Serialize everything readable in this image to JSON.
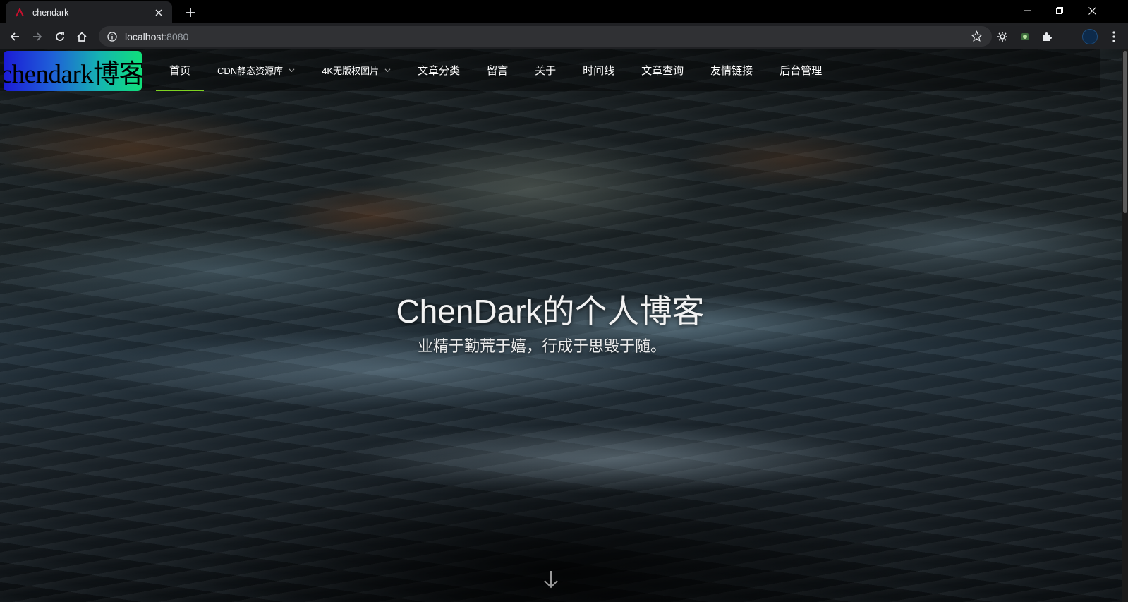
{
  "browser": {
    "tab_title": "chendark",
    "url_host": "localhost",
    "url_port": ":8080"
  },
  "site": {
    "logo_text": "chendark博客",
    "nav": [
      {
        "label": "首页"
      },
      {
        "label": "CDN静态资源库"
      },
      {
        "label": "4K无版权图片"
      },
      {
        "label": "文章分类"
      },
      {
        "label": "留言"
      },
      {
        "label": "关于"
      },
      {
        "label": "时间线"
      },
      {
        "label": "文章查询"
      },
      {
        "label": "友情链接"
      },
      {
        "label": "后台管理"
      }
    ],
    "active_nav": "首页",
    "accent_color": "#7ed321"
  },
  "hero": {
    "title": "ChenDark的个人博客",
    "subtitle": "业精于勤荒于嬉，行成于思毁于随。"
  },
  "icons": {
    "back": "arrow-left-icon",
    "forward": "arrow-right-icon",
    "reload": "reload-icon",
    "home": "home-icon",
    "info": "info-icon",
    "bookmark": "star-icon",
    "scroll_hint": "arrow-down-icon"
  }
}
